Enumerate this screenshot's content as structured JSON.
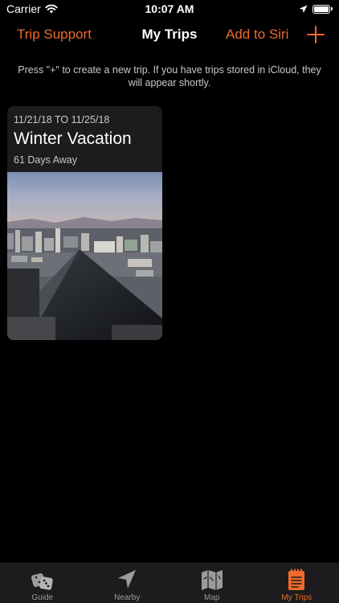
{
  "status_bar": {
    "carrier": "Carrier",
    "time": "10:07 AM"
  },
  "nav": {
    "left_label": "Trip Support",
    "title": "My Trips",
    "siri_label": "Add to Siri",
    "add_icon": "plus-icon"
  },
  "hint": "Press \"+\" to create a new trip. If you have trips stored in iCloud, they will appear shortly.",
  "trips": [
    {
      "dates": "11/21/18 TO 11/25/18",
      "name": "Winter Vacation",
      "away": "61 Days Away"
    }
  ],
  "tabs": [
    {
      "label": "Guide",
      "icon": "dice-icon",
      "active": false
    },
    {
      "label": "Nearby",
      "icon": "location-arrow-icon",
      "active": false
    },
    {
      "label": "Map",
      "icon": "map-icon",
      "active": false
    },
    {
      "label": "My Trips",
      "icon": "notepad-icon",
      "active": true
    }
  ],
  "colors": {
    "accent": "#ef6a2b",
    "background": "#000000",
    "card": "#1c1c1e",
    "secondary_text": "#c9c9c9",
    "tab_inactive": "#9b9b9b"
  }
}
